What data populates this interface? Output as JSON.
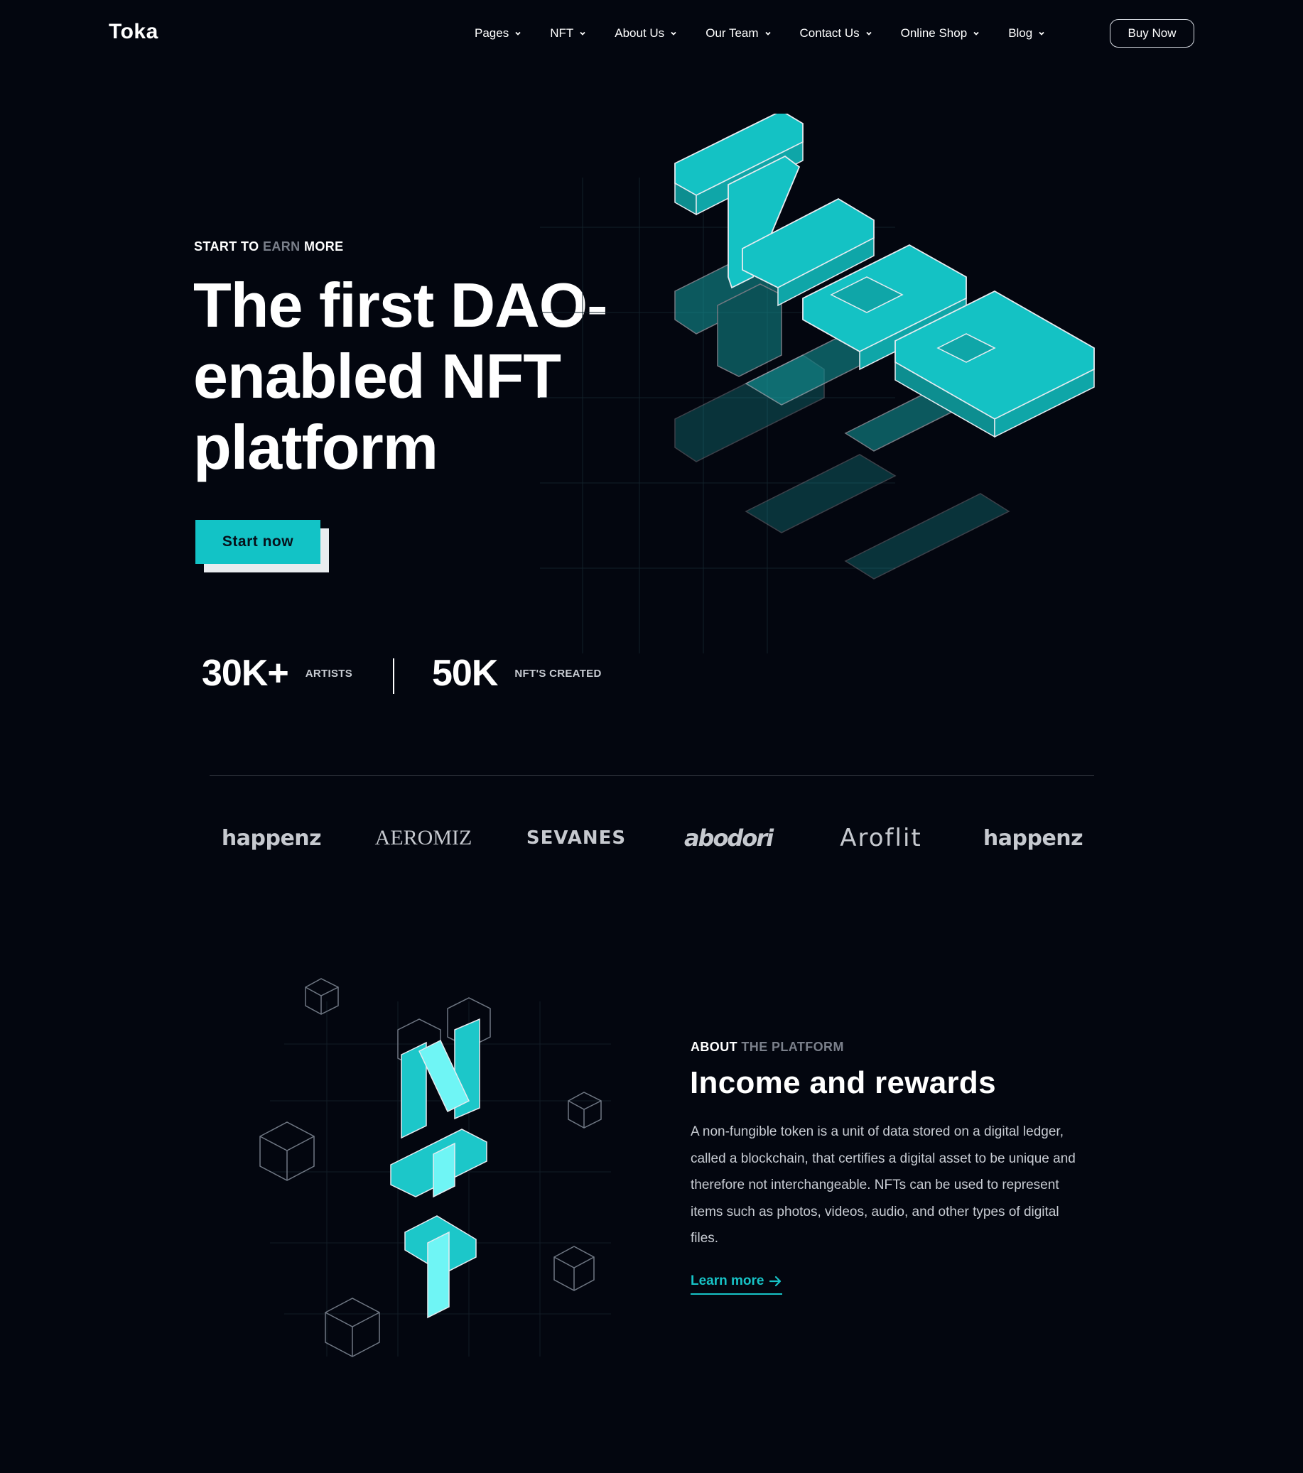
{
  "brand": {
    "logo": "Toka"
  },
  "nav": {
    "items": [
      {
        "label": "Pages"
      },
      {
        "label": "NFT"
      },
      {
        "label": "About Us"
      },
      {
        "label": "Our Team"
      },
      {
        "label": "Contact Us"
      },
      {
        "label": "Online Shop"
      },
      {
        "label": "Blog"
      }
    ],
    "cta": "Buy Now",
    "chevron_icon": "chevron-down-icon"
  },
  "hero": {
    "eyebrow_start": "START TO",
    "eyebrow_highlight": "EARN",
    "eyebrow_end": "MORE",
    "title": "The first DAO-enabled NFT platform",
    "button": "Start now",
    "art_text": "NFT",
    "stats": [
      {
        "value": "30K+",
        "label": "ARTISTS"
      },
      {
        "value": "50K",
        "label": "NFT'S CREATED"
      }
    ]
  },
  "partners": [
    "happenz",
    "AEROMIZ",
    "SEVANES",
    "abodori",
    "Aroflit",
    "happenz"
  ],
  "about": {
    "eyebrow_start": "ABOUT",
    "eyebrow_highlight": "THE PLATFORM",
    "title": "Income and rewards",
    "body": "A non-fungible token is a unit of data stored on a digital ledger, called a blockchain, that certifies a digital asset to be unique and therefore not interchangeable. NFTs can be used to represent items such as photos, videos, audio, and other types of digital files.",
    "link": "Learn more",
    "link_icon": "arrow-right-icon",
    "art_text": "NFT"
  },
  "colors": {
    "background": "#03060f",
    "accent": "#12c3c6",
    "muted_text": "#7a7f8a"
  }
}
